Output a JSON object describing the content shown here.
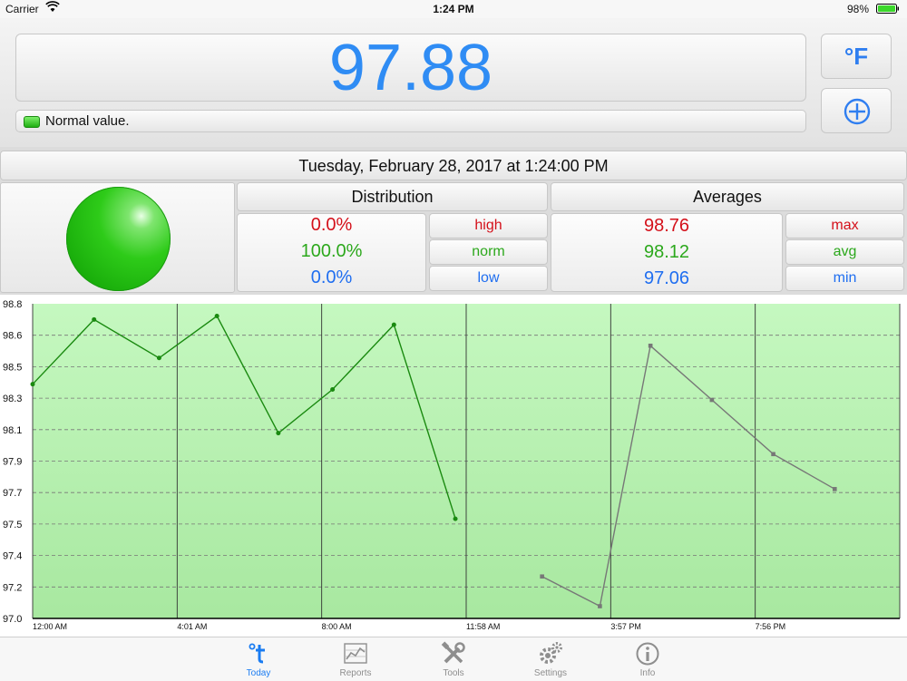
{
  "status_bar": {
    "carrier": "Carrier",
    "time": "1:24 PM",
    "battery": "98%"
  },
  "reading": {
    "value": "97.88",
    "status_text": "Normal value.",
    "unit_button": "°F",
    "color": "#2f8cf4"
  },
  "timestamp": "Tuesday, February 28, 2017 at 1:24:00 PM",
  "distribution": {
    "title": "Distribution",
    "high": "0.0%",
    "norm": "100.0%",
    "low": "0.0%",
    "labels": {
      "high": "high",
      "norm": "norm",
      "low": "low"
    }
  },
  "averages": {
    "title": "Averages",
    "max": "98.76",
    "avg": "98.12",
    "min": "97.06",
    "labels": {
      "max": "max",
      "avg": "avg",
      "min": "min"
    }
  },
  "chart_data": {
    "type": "line",
    "ylim": [
      97.0,
      98.8
    ],
    "y_ticks": [
      "97.0",
      "97.2",
      "97.4",
      "97.5",
      "97.7",
      "97.9",
      "98.1",
      "98.3",
      "98.5",
      "98.6",
      "98.8"
    ],
    "x_ticks": [
      "12:00 AM",
      "4:01 AM",
      "8:00 AM",
      "11:58 AM",
      "3:57 PM",
      "7:56 PM"
    ],
    "grid": true,
    "series": [
      {
        "color": "#1a8a10",
        "points": [
          {
            "t": 0.0,
            "y": 98.34
          },
          {
            "t": 1.7,
            "y": 98.71
          },
          {
            "t": 3.5,
            "y": 98.49
          },
          {
            "t": 5.1,
            "y": 98.73
          },
          {
            "t": 6.8,
            "y": 98.06
          },
          {
            "t": 8.3,
            "y": 98.31
          },
          {
            "t": 10.0,
            "y": 98.68
          },
          {
            "t": 11.7,
            "y": 97.57
          }
        ]
      },
      {
        "color": "#777777",
        "points": [
          {
            "t": 14.1,
            "y": 97.24
          },
          {
            "t": 15.7,
            "y": 97.07
          },
          {
            "t": 17.1,
            "y": 98.56
          },
          {
            "t": 18.8,
            "y": 98.25
          },
          {
            "t": 20.5,
            "y": 97.94
          },
          {
            "t": 22.2,
            "y": 97.74
          }
        ]
      }
    ],
    "colors": {
      "fill_top": "#c5f8c0",
      "fill_bottom": "#a8e8a0"
    }
  },
  "tabs": [
    {
      "id": "today",
      "label": "Today",
      "icon": "thermometer-t-icon",
      "active": true
    },
    {
      "id": "reports",
      "label": "Reports",
      "icon": "chart-icon",
      "active": false
    },
    {
      "id": "tools",
      "label": "Tools",
      "icon": "tools-icon",
      "active": false
    },
    {
      "id": "settings",
      "label": "Settings",
      "icon": "gear-icon",
      "active": false
    },
    {
      "id": "info",
      "label": "Info",
      "icon": "info-icon",
      "active": false
    }
  ]
}
